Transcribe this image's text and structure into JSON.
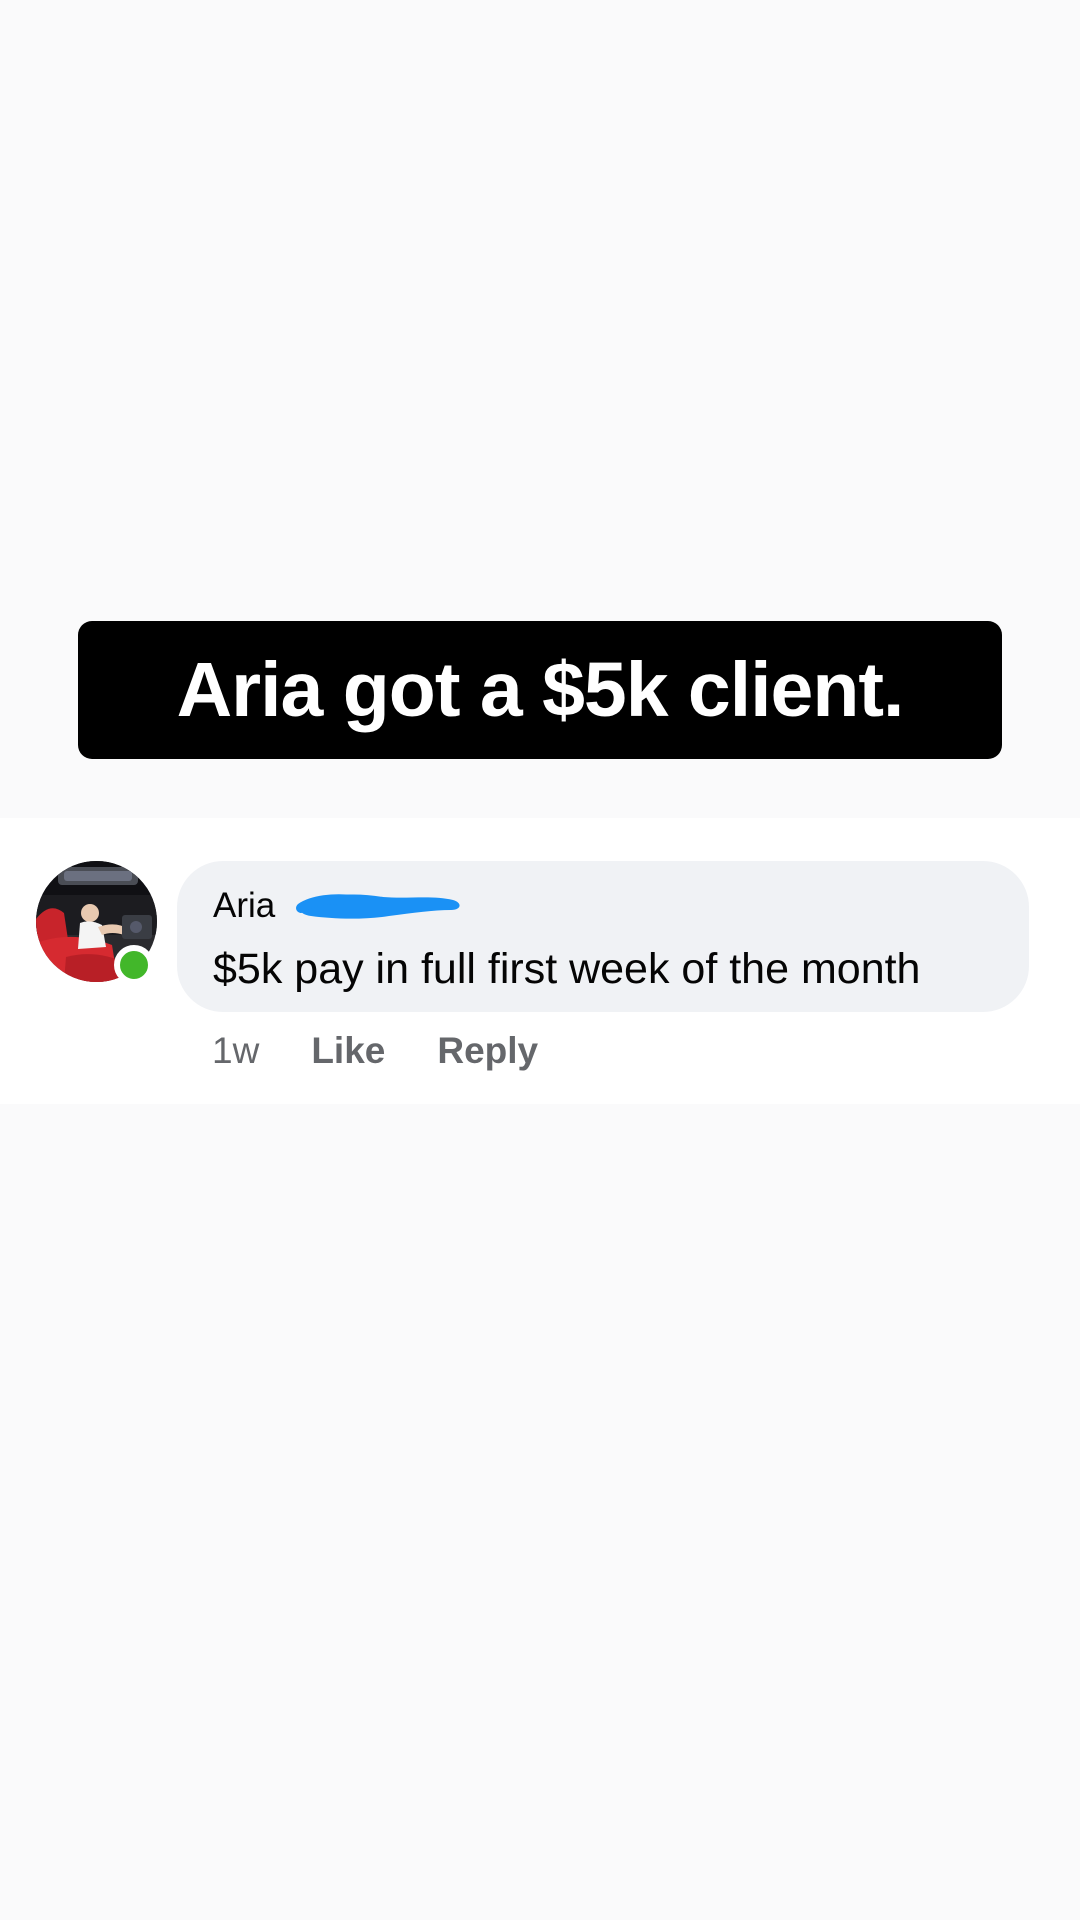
{
  "overlay": {
    "headline": "Aria got a $5k client."
  },
  "comment": {
    "author": "Aria",
    "text": "$5k pay in full first week of the month",
    "timestamp": "1w",
    "like_label": "Like",
    "reply_label": "Reply",
    "online": true
  },
  "colors": {
    "page_background": "#fafafb",
    "headline_background": "#000000",
    "headline_text": "#ffffff",
    "bubble_background": "#f0f2f5",
    "meta_text": "#65676b",
    "presence": "#42b72a",
    "redaction": "#1a91f5"
  }
}
